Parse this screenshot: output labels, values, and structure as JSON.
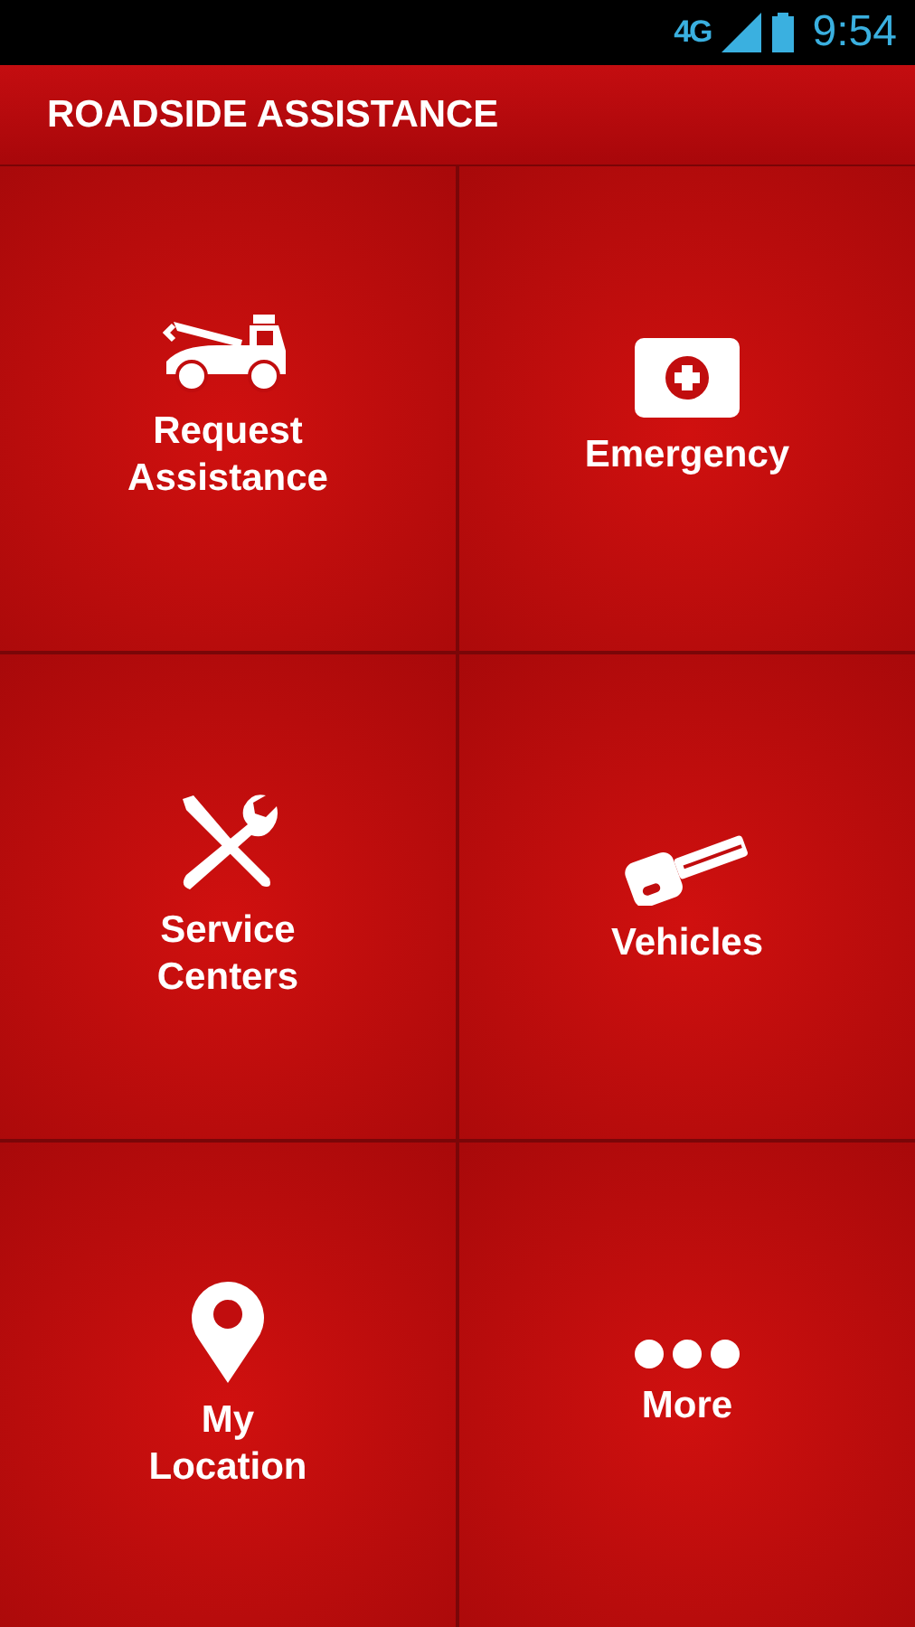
{
  "status_bar": {
    "network": "4G",
    "time": "9:54"
  },
  "app_bar": {
    "title": "ROADSIDE ASSISTANCE"
  },
  "tiles": [
    {
      "kind": "tow-truck",
      "label": "Request\nAssistance"
    },
    {
      "kind": "medical-kit",
      "label": "Emergency"
    },
    {
      "kind": "tools",
      "label": "Service\nCenters"
    },
    {
      "kind": "key",
      "label": "Vehicles"
    },
    {
      "kind": "pin",
      "label": "My\nLocation"
    },
    {
      "kind": "dots",
      "label": "More"
    }
  ]
}
